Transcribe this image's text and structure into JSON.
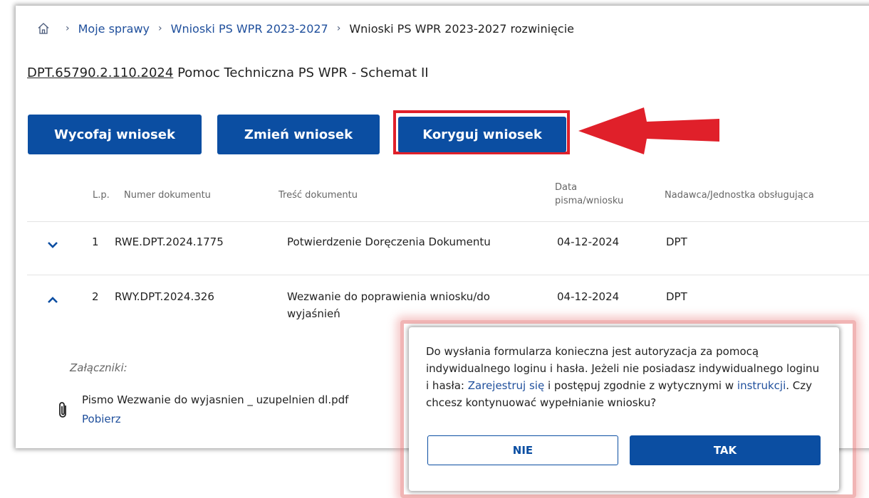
{
  "breadcrumb": {
    "items": [
      {
        "label": "Moje sprawy"
      },
      {
        "label": "Wnioski PS WPR 2023-2027"
      }
    ],
    "current": "Wnioski PS WPR 2023-2027 rozwinięcie"
  },
  "case": {
    "number": "DPT.65790.2.110.2024",
    "title": "Pomoc Techniczna PS WPR - Schemat II"
  },
  "actions": {
    "withdraw": "Wycofaj wniosek",
    "change": "Zmień wniosek",
    "correct": "Koryguj wniosek"
  },
  "annotation": {
    "highlight_color": "#e0202a",
    "arrow_color": "#e0202a"
  },
  "table": {
    "headers": {
      "lp": "L.p.",
      "number": "Numer dokumentu",
      "content": "Treść dokumentu",
      "date_line1": "Data",
      "date_line2": "pisma/wniosku",
      "sender": "Nadawca/Jednostka obsługująca"
    },
    "rows": [
      {
        "lp": "1",
        "number": "RWE.DPT.2024.1775",
        "content_line1": "Potwierdzenie Doręczenia Dokumentu",
        "content_line2": "",
        "date": "04-12-2024",
        "sender": "DPT",
        "expanded": false
      },
      {
        "lp": "2",
        "number": "RWY.DPT.2024.326",
        "content_line1": "Wezwanie do poprawienia wniosku/do",
        "content_line2": "wyjaśnień",
        "date": "04-12-2024",
        "sender": "DPT",
        "expanded": true
      }
    ]
  },
  "attachments": {
    "label": "Załączniki:",
    "file_name": "Pismo Wezwanie do wyjasnien _ uzupelnien dl.pdf",
    "download": "Pobierz"
  },
  "modal": {
    "text_part1": "Do wysłania formularza konieczna jest autoryzacja za pomocą indywidualnego loginu i hasła. Jeżeli nie posiadasz indywidualnego loginu i hasła:",
    "register_link": "Zarejestruj się",
    "text_part2": "i postępuj zgodnie z wytycznymi w",
    "instructions_link": "instrukcji",
    "text_part3": ". Czy chcesz kontynuować wypełnianie wniosku?",
    "no_label": "NIE",
    "yes_label": "TAK"
  },
  "colors": {
    "primary": "#0b4ea2",
    "link": "#1f4f9c",
    "annotation": "#e0202a"
  }
}
